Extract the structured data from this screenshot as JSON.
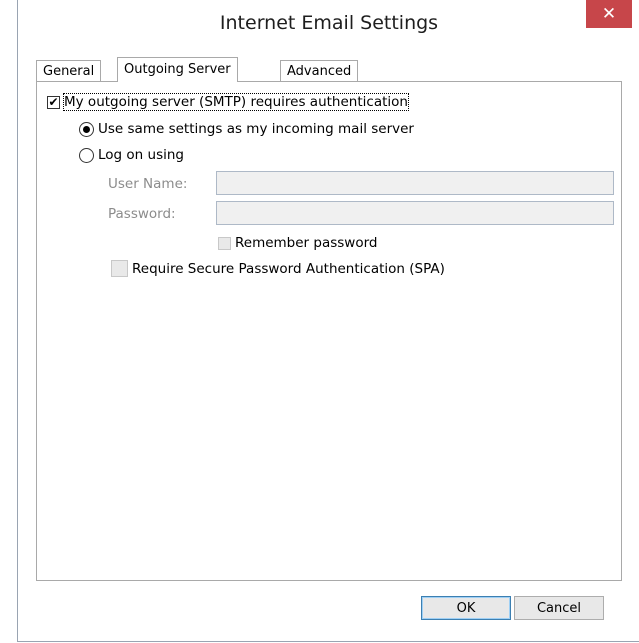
{
  "dialog": {
    "title": "Internet Email Settings",
    "close_label": "✕"
  },
  "tabs": [
    {
      "label": "General",
      "active": false
    },
    {
      "label": "Outgoing Server",
      "active": true
    },
    {
      "label": "Advanced",
      "active": false
    }
  ],
  "outgoing": {
    "smtp_auth": {
      "label": "My outgoing server (SMTP) requires authentication",
      "checked": true
    },
    "use_same": {
      "label": "Use same settings as my incoming mail server",
      "selected": true
    },
    "log_on": {
      "label": "Log on using",
      "selected": false
    },
    "user_name_label": "User Name:",
    "user_name_value": "",
    "password_label": "Password:",
    "password_value": "",
    "remember_password": {
      "label": "Remember password",
      "checked": false,
      "enabled": false
    },
    "require_spa": {
      "label": "Require Secure Password Authentication (SPA)",
      "checked": false,
      "enabled": false
    }
  },
  "buttons": {
    "ok": "OK",
    "cancel": "Cancel"
  }
}
